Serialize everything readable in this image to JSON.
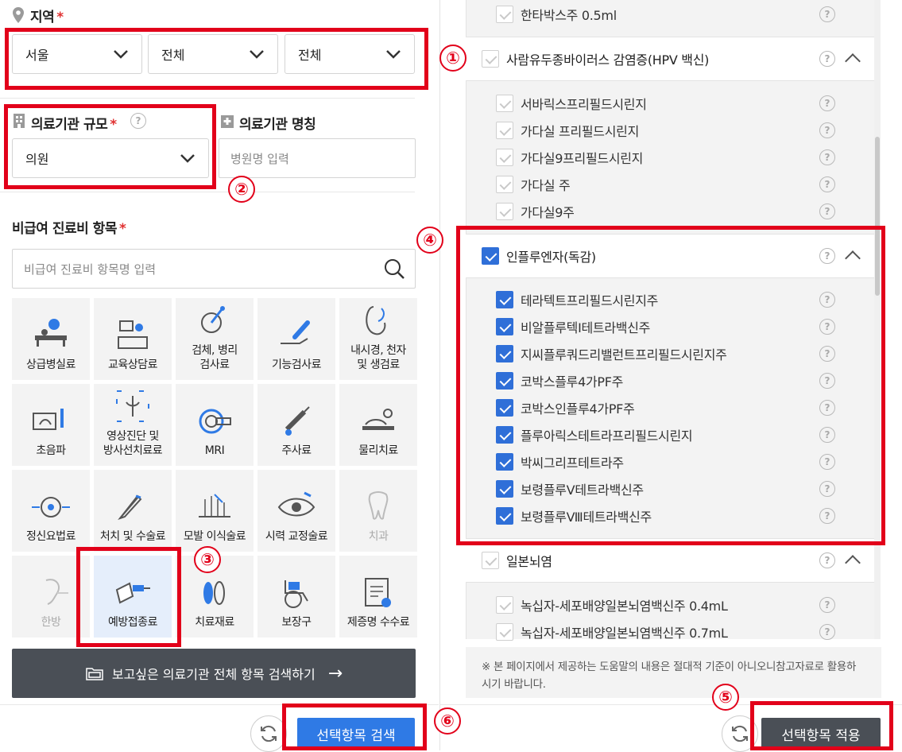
{
  "region": {
    "title": "지역",
    "required_mark": "*",
    "selects": [
      "서울",
      "전체",
      "전체"
    ]
  },
  "facility_scale": {
    "title": "의료기관 규모",
    "required_mark": "*",
    "value": "의원"
  },
  "facility_name": {
    "title": "의료기관 명칭",
    "placeholder": "병원명 입력"
  },
  "nonpay": {
    "title": "비급여 진료비 항목",
    "required_mark": "*",
    "placeholder": "비급여 진료비 항목명 입력"
  },
  "tiles": [
    {
      "label": "상급병실료",
      "icon": "hospital-bed-icon",
      "dim": false,
      "selected": false
    },
    {
      "label": "교육상담료",
      "icon": "counseling-desk-icon",
      "dim": false,
      "selected": false
    },
    {
      "label": "검체, 병리\n검사료",
      "icon": "pathology-test-icon",
      "dim": false,
      "selected": false
    },
    {
      "label": "기능검사료",
      "icon": "function-test-icon",
      "dim": false,
      "selected": false
    },
    {
      "label": "내시경, 천자\n및 생검료",
      "icon": "endoscope-icon",
      "dim": false,
      "selected": false
    },
    {
      "label": "초음파",
      "icon": "ultrasound-icon",
      "dim": false,
      "selected": false
    },
    {
      "label": "영상진단 및\n방사선치료료",
      "icon": "xray-icon",
      "dim": false,
      "selected": false
    },
    {
      "label": "MRI",
      "icon": "mri-icon",
      "dim": false,
      "selected": false
    },
    {
      "label": "주사료",
      "icon": "syringe-icon",
      "dim": false,
      "selected": false
    },
    {
      "label": "물리치료",
      "icon": "physical-therapy-icon",
      "dim": false,
      "selected": false
    },
    {
      "label": "정신요법료",
      "icon": "brain-icon",
      "dim": false,
      "selected": false
    },
    {
      "label": "처치 및 수술료",
      "icon": "scalpel-icon",
      "dim": false,
      "selected": false
    },
    {
      "label": "모발 이식술료",
      "icon": "hair-transplant-icon",
      "dim": false,
      "selected": false
    },
    {
      "label": "시력 교정술료",
      "icon": "eye-icon",
      "dim": false,
      "selected": false
    },
    {
      "label": "치과",
      "icon": "tooth-icon",
      "dim": true,
      "selected": false
    },
    {
      "label": "한방",
      "icon": "ear-acupuncture-icon",
      "dim": true,
      "selected": false
    },
    {
      "label": "예방접종료",
      "icon": "vaccine-icon",
      "dim": false,
      "selected": true
    },
    {
      "label": "치료재료",
      "icon": "lens-material-icon",
      "dim": false,
      "selected": false
    },
    {
      "label": "보장구",
      "icon": "wheelchair-icon",
      "dim": false,
      "selected": false
    },
    {
      "label": "제증명 수수료",
      "icon": "certificate-icon",
      "dim": false,
      "selected": false
    }
  ],
  "search_all_button": "보고싶은 의료기관 전체 항목 검색하기",
  "search_selected_button": "선택항목 검색",
  "apply_selected_button": "선택항목 적용",
  "notice": "※ 본 페이지에서 제공하는 도움말의 내용은 절대적 기준이 아니오니참고자료로 활용하시기 바랍니다.",
  "markers": [
    "①",
    "②",
    "③",
    "④",
    "⑤",
    "⑥"
  ],
  "vaccine_list": {
    "top_item": "한타박스주 0.5ml",
    "groups": [
      {
        "name": "사람유두종바이러스 감염증(HPV 백신)",
        "checked": false,
        "items": [
          "서바릭스프리필드시린지",
          "가다실 프리필드시린지",
          "가다실9프리필드시린지",
          "가다실 주",
          "가다실9주"
        ]
      },
      {
        "name": "인플루엔자(독감)",
        "checked": true,
        "items": [
          "테라텍트프리필드시린지주",
          "비알플루텍I테트라백신주",
          "지씨플루쿼드리밸런트프리필드시린지주",
          "코박스플루4가PF주",
          "코박스인플루4가PF주",
          "플루아릭스테트라프리필드시린지",
          "박씨그리프테트라주",
          "보령플루Ⅴ테트라백신주",
          "보령플루Ⅷ테트라백신주"
        ]
      },
      {
        "name": "일본뇌염",
        "checked": false,
        "items": [
          "녹십자-세포배양일본뇌염백신주 0.4mL",
          "녹십자-세포배양일본뇌염백신주 0.7mL"
        ]
      }
    ]
  },
  "colors": {
    "accent": "#2f7ae5",
    "annotation": "#e2001a",
    "dark_button": "#4a4f56"
  }
}
